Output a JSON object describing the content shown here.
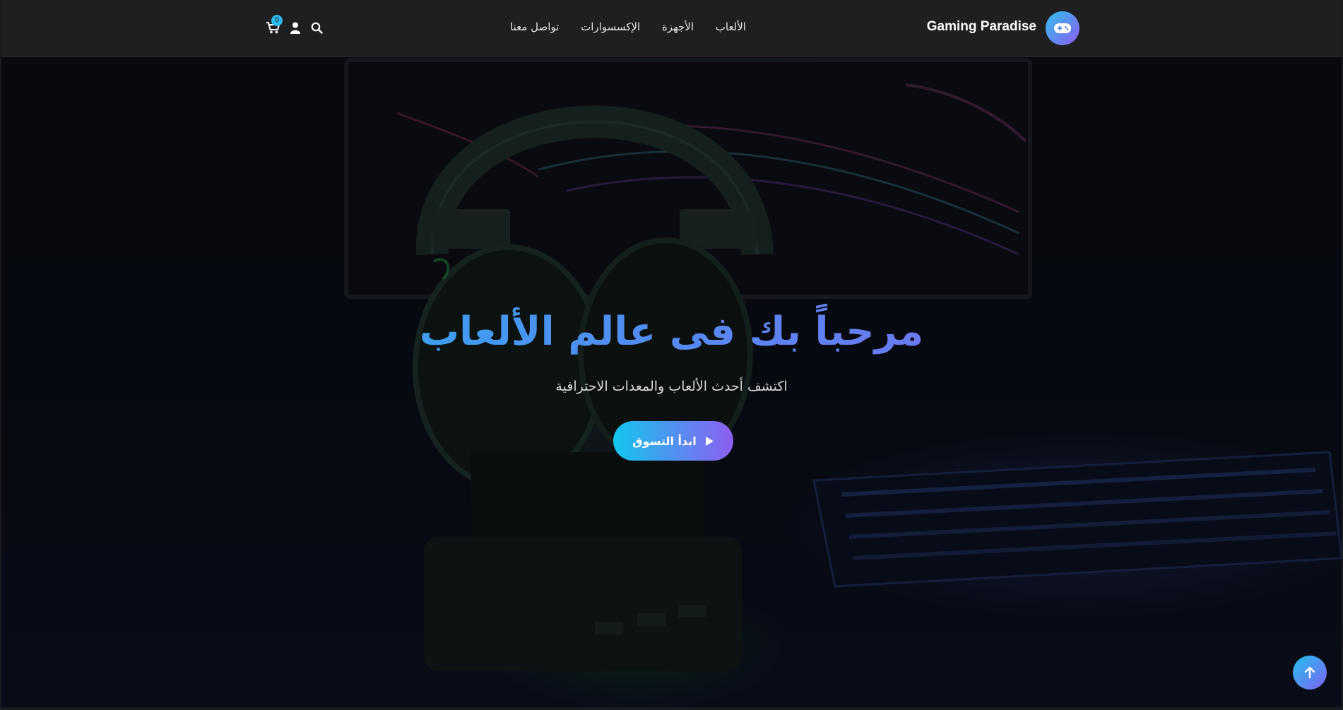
{
  "brand": {
    "name": "Gaming Paradise",
    "logo_icon": "gamepad-icon"
  },
  "nav": {
    "links": [
      {
        "label": "الألعاب"
      },
      {
        "label": "الأجهزة"
      },
      {
        "label": "الإكسسوارات"
      },
      {
        "label": "تواصل معنا"
      }
    ],
    "icons": [
      "search-icon",
      "user-icon",
      "cart-icon"
    ],
    "cart_count": "0"
  },
  "hero": {
    "title": "مرحباً بك فى عالم الألعاب",
    "subtitle": "اكتشف أحدث الألعاب والمعدات الاحترافية",
    "cta_label": "ابدأ التسوق",
    "cta_icon": "play-icon"
  },
  "scroll_top_icon": "arrow-up-icon",
  "colors": {
    "accent_start": "#16c3ee",
    "accent_end": "#8d5ef0",
    "navbar_bg": "#202023"
  }
}
